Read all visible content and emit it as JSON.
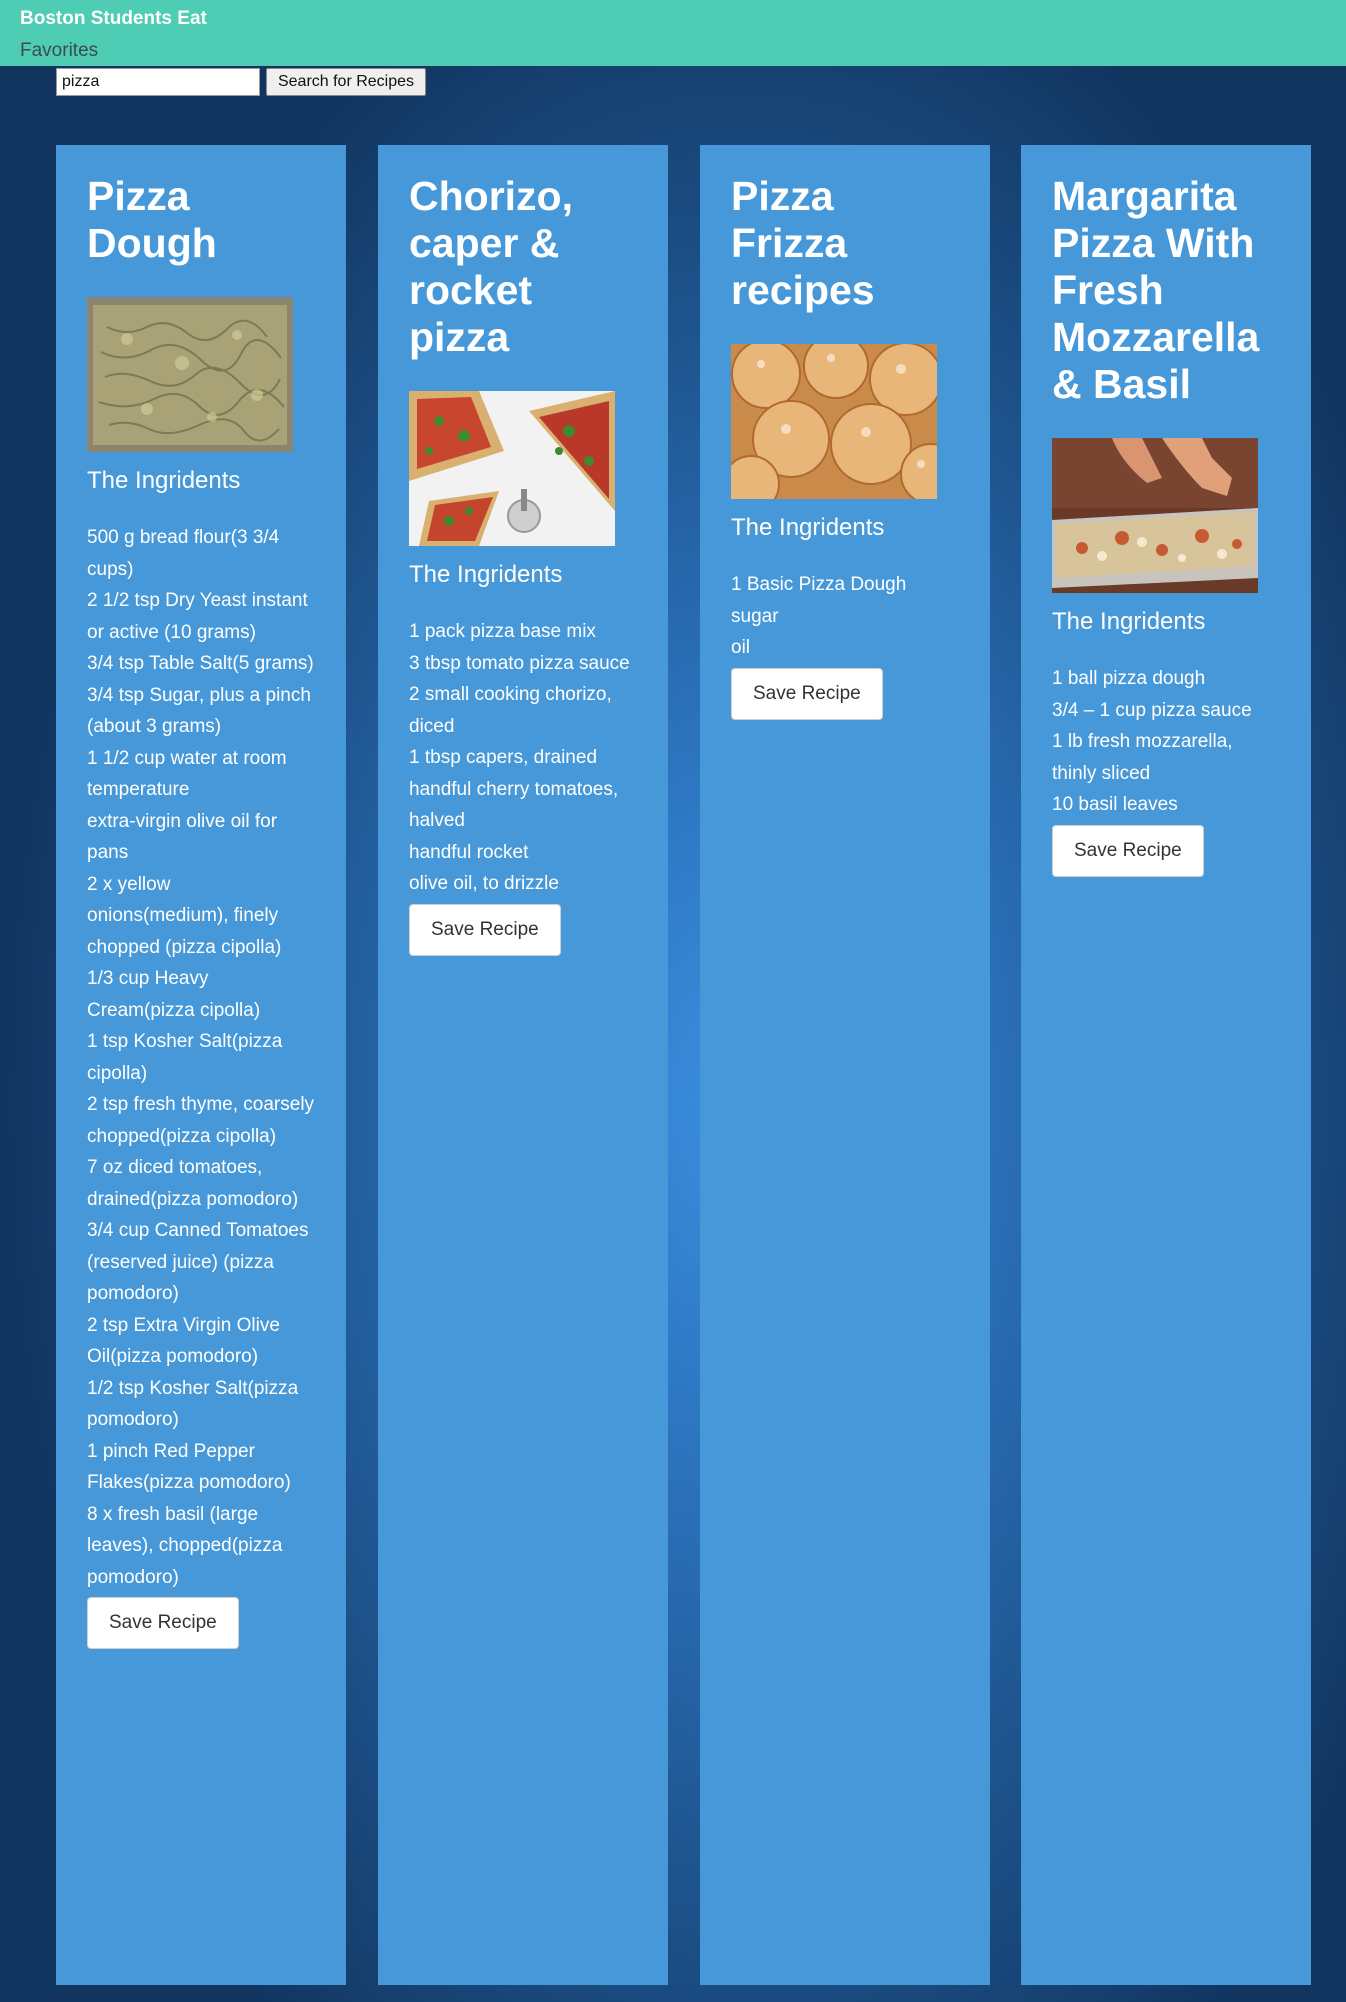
{
  "header": {
    "brand": "Boston Students Eat",
    "nav_favorites": "Favorites"
  },
  "search": {
    "value": "pizza",
    "button_label": "Search for Recipes"
  },
  "colors": {
    "navbar": "#4ecdb4",
    "card": "#4698d8",
    "background_center": "#3a8fe0",
    "background_edge": "#123560"
  },
  "ingredients_heading": "The Ingridents",
  "save_label": "Save Recipe",
  "recipes": [
    {
      "title": "Pizza Dough",
      "image": "pizza-dough-photo",
      "ingredients": [
        "500 g bread flour(3 3/4 cups)",
        "2 1/2 tsp Dry Yeast instant or active (10 grams)",
        "3/4 tsp Table Salt(5 grams)",
        "3/4 tsp Sugar, plus a pinch (about 3 grams)",
        "1 1/2 cup water at room temperature",
        "extra-virgin olive oil for pans",
        "2 x yellow onions(medium), finely chopped (pizza cipolla)",
        "1/3 cup Heavy Cream(pizza cipolla)",
        "1 tsp Kosher Salt(pizza cipolla)",
        "2 tsp fresh thyme, coarsely chopped(pizza cipolla)",
        "7 oz diced tomatoes, drained(pizza pomodoro)",
        "3/4 cup Canned Tomatoes (reserved juice) (pizza pomodoro)",
        "2 tsp Extra Virgin Olive Oil(pizza pomodoro)",
        "1/2 tsp Kosher Salt(pizza pomodoro)",
        "1 pinch Red Pepper Flakes(pizza pomodoro)",
        "8 x fresh basil (large leaves), chopped(pizza pomodoro)"
      ]
    },
    {
      "title": "Chorizo, caper & rocket pizza",
      "image": "chorizo-rocket-pizza-photo",
      "ingredients": [
        "1 pack pizza base mix",
        "3 tbsp tomato pizza sauce",
        "2 small cooking chorizo, diced",
        "1 tbsp capers, drained",
        "handful cherry tomatoes, halved",
        "handful rocket",
        "olive oil, to drizzle"
      ]
    },
    {
      "title": "Pizza Frizza recipes",
      "image": "sugared-dough-balls-photo",
      "ingredients": [
        "1 Basic Pizza Dough",
        "sugar",
        "oil"
      ]
    },
    {
      "title": "Margarita Pizza With Fresh Mozzarella & Basil",
      "image": "margarita-pizza-photo",
      "ingredients": [
        "1 ball pizza dough",
        "3/4 – 1 cup pizza sauce",
        "1 lb fresh mozzarella, thinly sliced",
        "10 basil leaves"
      ]
    }
  ]
}
